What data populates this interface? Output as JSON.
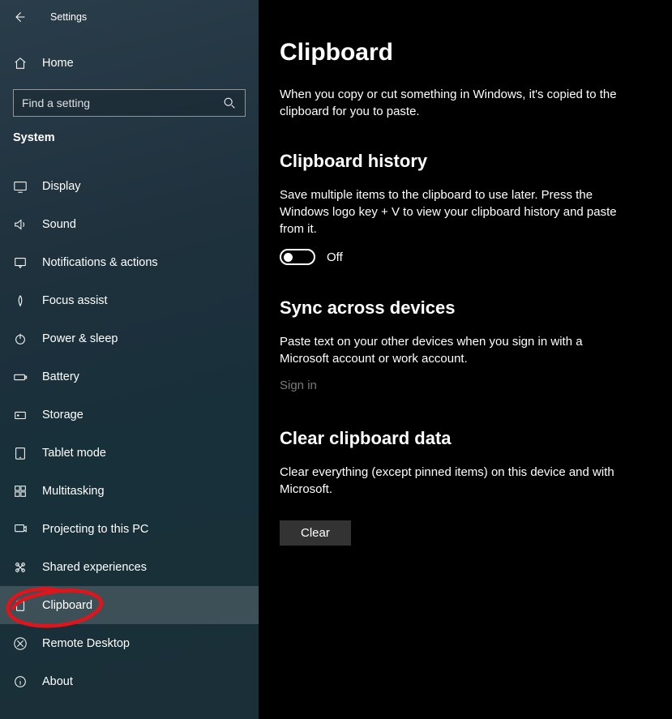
{
  "header": {
    "title": "Settings"
  },
  "sidebar": {
    "home": "Home",
    "search_placeholder": "Find a setting",
    "section": "System",
    "items": [
      {
        "label": "Display"
      },
      {
        "label": "Sound"
      },
      {
        "label": "Notifications & actions"
      },
      {
        "label": "Focus assist"
      },
      {
        "label": "Power & sleep"
      },
      {
        "label": "Battery"
      },
      {
        "label": "Storage"
      },
      {
        "label": "Tablet mode"
      },
      {
        "label": "Multitasking"
      },
      {
        "label": "Projecting to this PC"
      },
      {
        "label": "Shared experiences"
      },
      {
        "label": "Clipboard"
      },
      {
        "label": "Remote Desktop"
      },
      {
        "label": "About"
      }
    ]
  },
  "main": {
    "title": "Clipboard",
    "intro": "When you copy or cut something in Windows, it's copied to the clipboard for you to paste.",
    "history": {
      "heading": "Clipboard history",
      "desc": "Save multiple items to the clipboard to use later. Press the Windows logo key + V to view your clipboard history and paste from it.",
      "toggle_state": "Off"
    },
    "sync": {
      "heading": "Sync across devices",
      "desc": "Paste text on your other devices when you sign in with a Microsoft account or work account.",
      "signin": "Sign in"
    },
    "clear": {
      "heading": "Clear clipboard data",
      "desc": "Clear everything (except pinned items) on this device and with Microsoft.",
      "button": "Clear"
    }
  }
}
